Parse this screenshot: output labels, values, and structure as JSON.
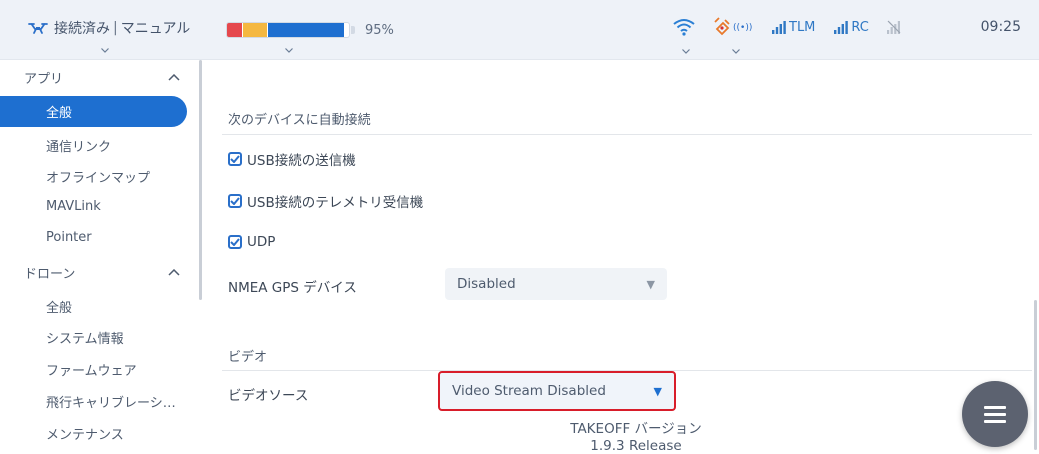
{
  "topbar": {
    "connection_status": "接続済み",
    "separator": "|",
    "flight_mode": "マニュアル",
    "battery_percent": "95%",
    "battery_level": 0.95,
    "tlm_label": "TLM",
    "rc_label": "RC",
    "time": "09:25",
    "icons": [
      "drone-icon",
      "wifi-icon",
      "gps-icon",
      "signal-tlm-icon",
      "signal-rc-icon",
      "no-signal-icon"
    ]
  },
  "sidebar": {
    "app_section": {
      "label": "アプリ",
      "collapsed": false
    },
    "app_items": [
      {
        "label": "全般",
        "active": true
      },
      {
        "label": "通信リンク"
      },
      {
        "label": "オフラインマップ"
      },
      {
        "label": "MAVLink"
      },
      {
        "label": "Pointer"
      }
    ],
    "drone_section": {
      "label": "ドローン",
      "collapsed": false
    },
    "drone_items": [
      {
        "label": "全般"
      },
      {
        "label": "システム情報"
      },
      {
        "label": "ファームウェア"
      },
      {
        "label": "飛行キャリブレーシ…"
      },
      {
        "label": "メンテナンス"
      }
    ]
  },
  "main": {
    "autoconnect_heading": "次のデバイスに自動接続",
    "checkboxes": [
      {
        "label": "USB接続の送信機",
        "checked": true
      },
      {
        "label": "USB接続のテレメトリ受信機",
        "checked": true
      },
      {
        "label": "UDP",
        "checked": true
      }
    ],
    "nmea_label": "NMEA GPS デバイス",
    "nmea_value": "Disabled",
    "video_heading": "ビデオ",
    "video_source_label": "ビデオソース",
    "video_source_value": "Video Stream Disabled",
    "version_label": "TAKEOFF バージョン",
    "version_value": "1.9.3 Release"
  },
  "colors": {
    "accent": "#1e6fd0",
    "highlight_border": "#d81d2a",
    "battery_red": "#e5484d",
    "battery_yellow": "#f5b841",
    "battery_blue": "#1e6fd0",
    "signal_blue": "#2f78c4",
    "gps_orange": "#e8792b"
  }
}
